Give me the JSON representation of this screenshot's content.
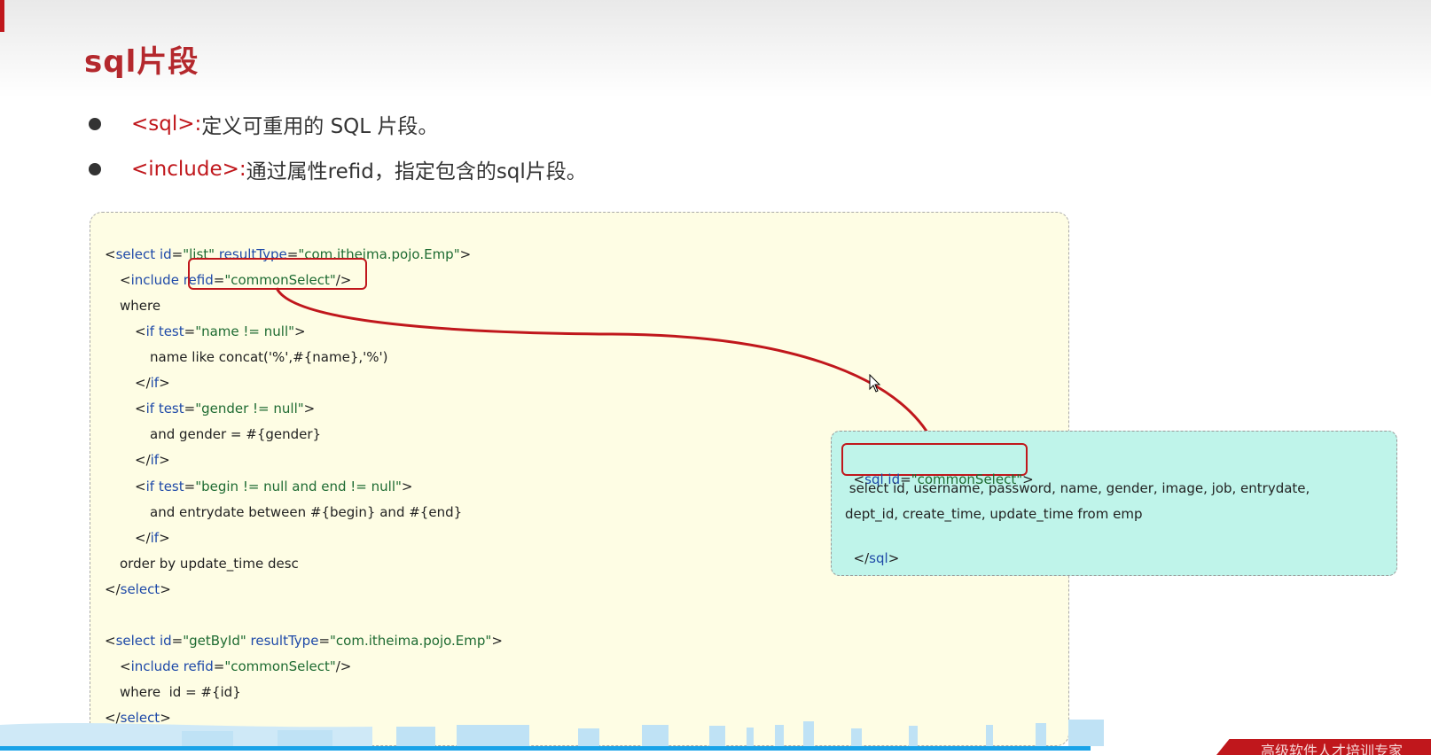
{
  "slide": {
    "title": "sql片段",
    "bullets": [
      {
        "tag": "<sql>:",
        "text": "定义可重用的 SQL 片段。"
      },
      {
        "tag": "<include>:",
        "text": "通过属性refid，指定包含的sql片段。"
      }
    ]
  },
  "code_main": {
    "lines": [
      "<select id=\"list\" resultType=\"com.itheima.pojo.Emp\">",
      "<include refid=\"commonSelect\"/>",
      "where",
      "<if test=\"name != null\">",
      "name like concat('%',#{name},'%')",
      "</if>",
      "<if test=\"gender != null\">",
      "and gender = #{gender}",
      "</if>",
      "<if test=\"begin != null and end != null\">",
      "and entrydate between #{begin} and #{end}",
      "</if>",
      "order by update_time desc",
      "</select>",
      "<select id=\"getById\" resultType=\"com.itheima.pojo.Emp\">",
      "<include refid=\"commonSelect\"/>",
      "where  id = #{id}",
      "</select>"
    ]
  },
  "code_sql": {
    "line1": "<sql id=\"commonSelect\">",
    "line2": " select id, username, password, name, gender, image, job, entrydate,",
    "line3": "dept_id, create_time, update_time from emp",
    "line4": "</sql>"
  },
  "footer": {
    "brand": "高级软件人才培训专家"
  },
  "colors": {
    "accent_red": "#c0171c",
    "title_red": "#b4282d",
    "code_bg": "#fefde4",
    "sql_bg": "#bff4ea",
    "keyword_blue": "#1f4aa8",
    "string_green": "#1e6b32",
    "footer_blue": "#1aa3e8"
  }
}
